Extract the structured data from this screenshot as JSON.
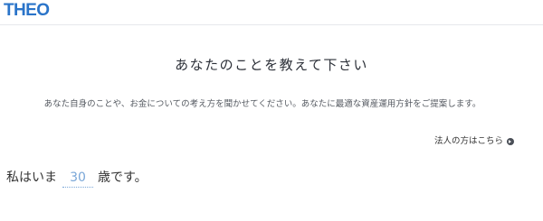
{
  "header": {
    "logo": "THEO"
  },
  "main": {
    "title": "あなたのことを教えて下さい",
    "lead": "あなた自身のことや、お金についての考え方を聞かせてください。あなたに最適な資産運用方針をご提案します。",
    "corporate_link": "法人の方はこちら",
    "age_question": {
      "prefix": "私はいま",
      "value": "30",
      "suffix": "歳です。"
    }
  },
  "colors": {
    "brand": "#2a74c9",
    "input_text": "#7aa7d8"
  }
}
